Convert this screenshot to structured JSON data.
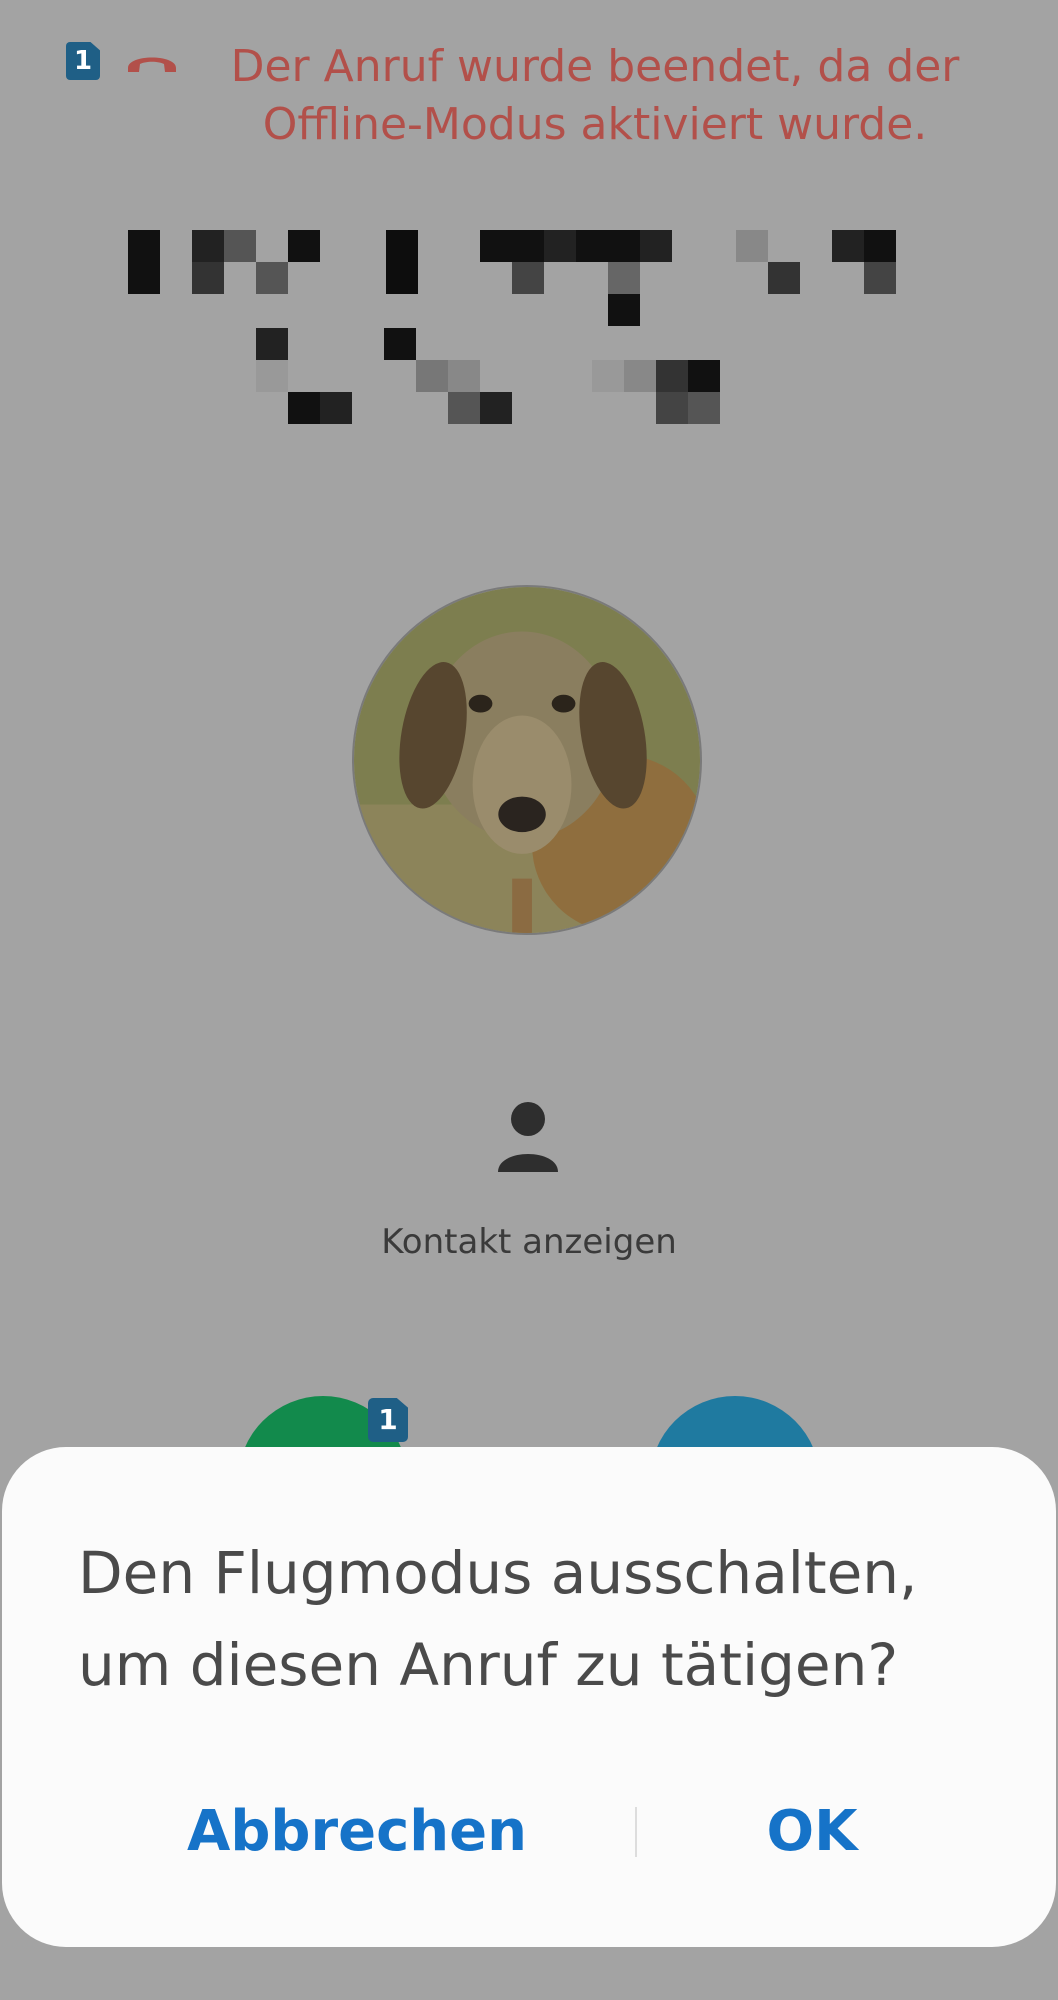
{
  "status": {
    "sim_number": "1",
    "message_line1": "Der Anruf wurde beendet, da der",
    "message_line2": "Offline-Modus aktiviert wurde."
  },
  "contact": {
    "view_label": "Kontakt anzeigen"
  },
  "call_buttons": {
    "sim_number": "1"
  },
  "dialog": {
    "title_line1": "Den Flugmodus ausschalten,",
    "title_line2": "um diesen Anruf zu tätigen?",
    "cancel_label": "Abbrechen",
    "ok_label": "OK"
  },
  "colors": {
    "background_dim": "#a3a3a3",
    "status_text": "#b2504a",
    "accent": "#1673c8",
    "sim_badge": "#1f5f86",
    "call_green": "#128a4c",
    "call_blue": "#1f7aa0"
  }
}
